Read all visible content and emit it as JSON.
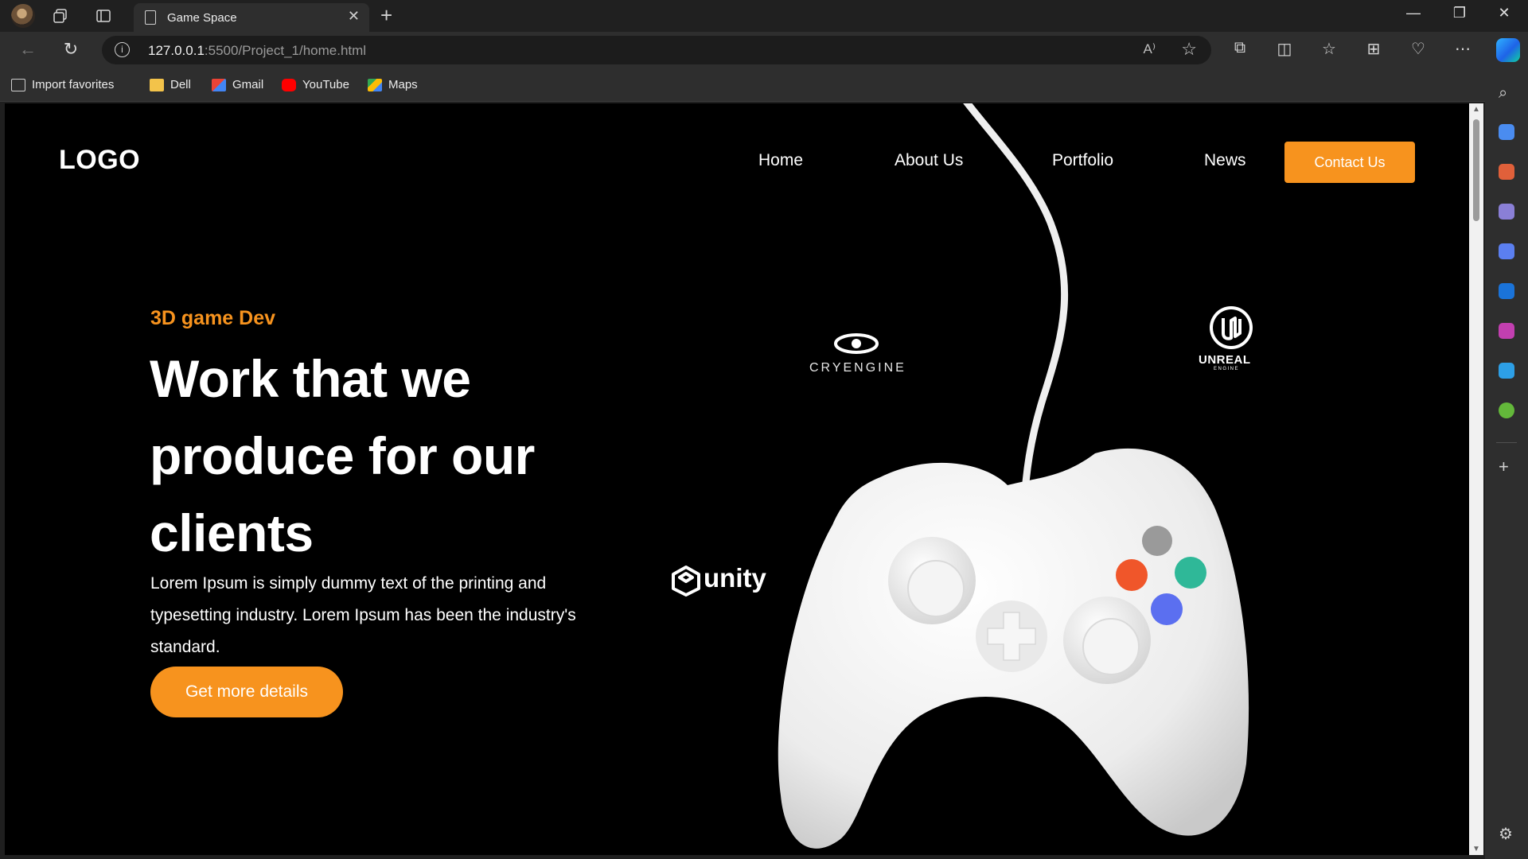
{
  "browser": {
    "tab_title": "Game Space",
    "url_host": "127.0.0.1",
    "url_rest": ":5500/Project_1/home.html",
    "bookmarks": [
      {
        "label": "Import favorites",
        "icon": "import-icon"
      },
      {
        "label": "Dell",
        "icon": "folder-icon"
      },
      {
        "label": "Gmail",
        "icon": "gmail-icon"
      },
      {
        "label": "YouTube",
        "icon": "youtube-icon"
      },
      {
        "label": "Maps",
        "icon": "maps-icon"
      }
    ]
  },
  "site": {
    "logo": "LOGO",
    "nav": [
      "Home",
      "About Us",
      "Portfolio",
      "News"
    ],
    "contact_label": "Contact Us",
    "eyebrow": "3D game Dev",
    "headline": "Work that we produce for our clients",
    "body": "Lorem Ipsum is simply dummy text of the printing and typesetting industry. Lorem Ipsum has been the industry's standard.",
    "cta_label": "Get more details",
    "engines": {
      "cryengine": "CRYENGINE",
      "unity": "unity",
      "unreal": "UNREAL",
      "unreal_sub": "ENGINE"
    }
  },
  "colors": {
    "accent": "#f7931e",
    "page_bg": "#000000",
    "chrome_bg": "#2e2e2e"
  }
}
